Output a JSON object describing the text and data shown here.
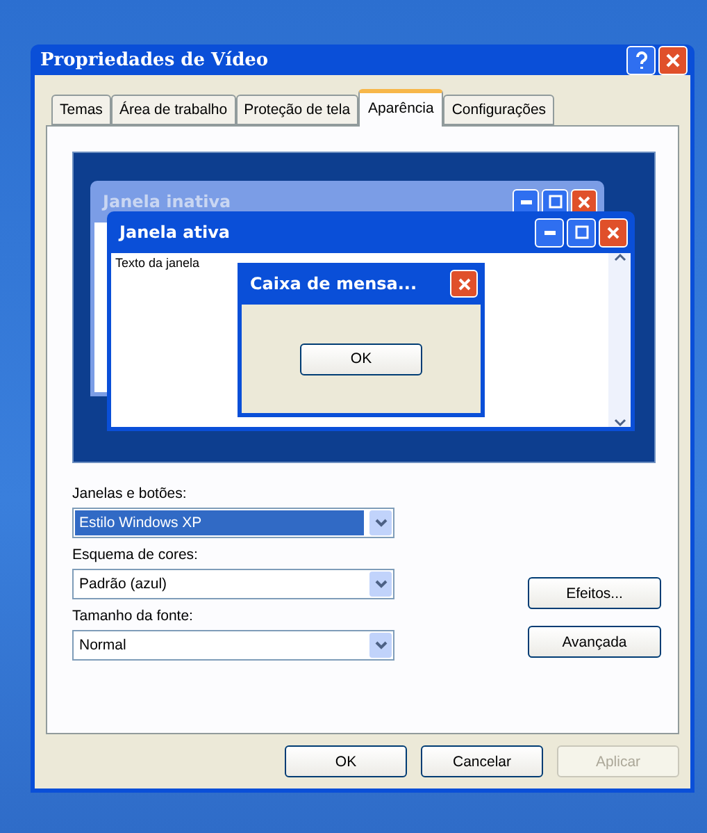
{
  "window": {
    "title": "Propriedades de Vídeo"
  },
  "tabs": [
    {
      "label": "Temas",
      "selected": false
    },
    {
      "label": "Área de trabalho",
      "selected": false
    },
    {
      "label": "Proteção de tela",
      "selected": false
    },
    {
      "label": "Aparência",
      "selected": true
    },
    {
      "label": "Configurações",
      "selected": false
    }
  ],
  "preview": {
    "inactive_window": {
      "title": "Janela inativa"
    },
    "active_window": {
      "title": "Janela ativa",
      "text": "Texto da janela"
    },
    "message_box": {
      "title": "Caixa de mensa...",
      "button": "OK"
    }
  },
  "fields": [
    {
      "label": "Janelas e botões:",
      "value": "Estilo Windows XP",
      "focused": true
    },
    {
      "label": "Esquema de cores:",
      "value": "Padrão (azul)",
      "focused": false
    },
    {
      "label": "Tamanho da fonte:",
      "value": "Normal",
      "focused": false
    }
  ],
  "side_buttons": [
    {
      "label": "Efeitos...",
      "disabled": false
    },
    {
      "label": "Avançada",
      "disabled": false
    }
  ],
  "buttons": [
    {
      "label": "OK",
      "disabled": false
    },
    {
      "label": "Cancelar",
      "disabled": false
    },
    {
      "label": "Aplicar",
      "disabled": true
    }
  ]
}
